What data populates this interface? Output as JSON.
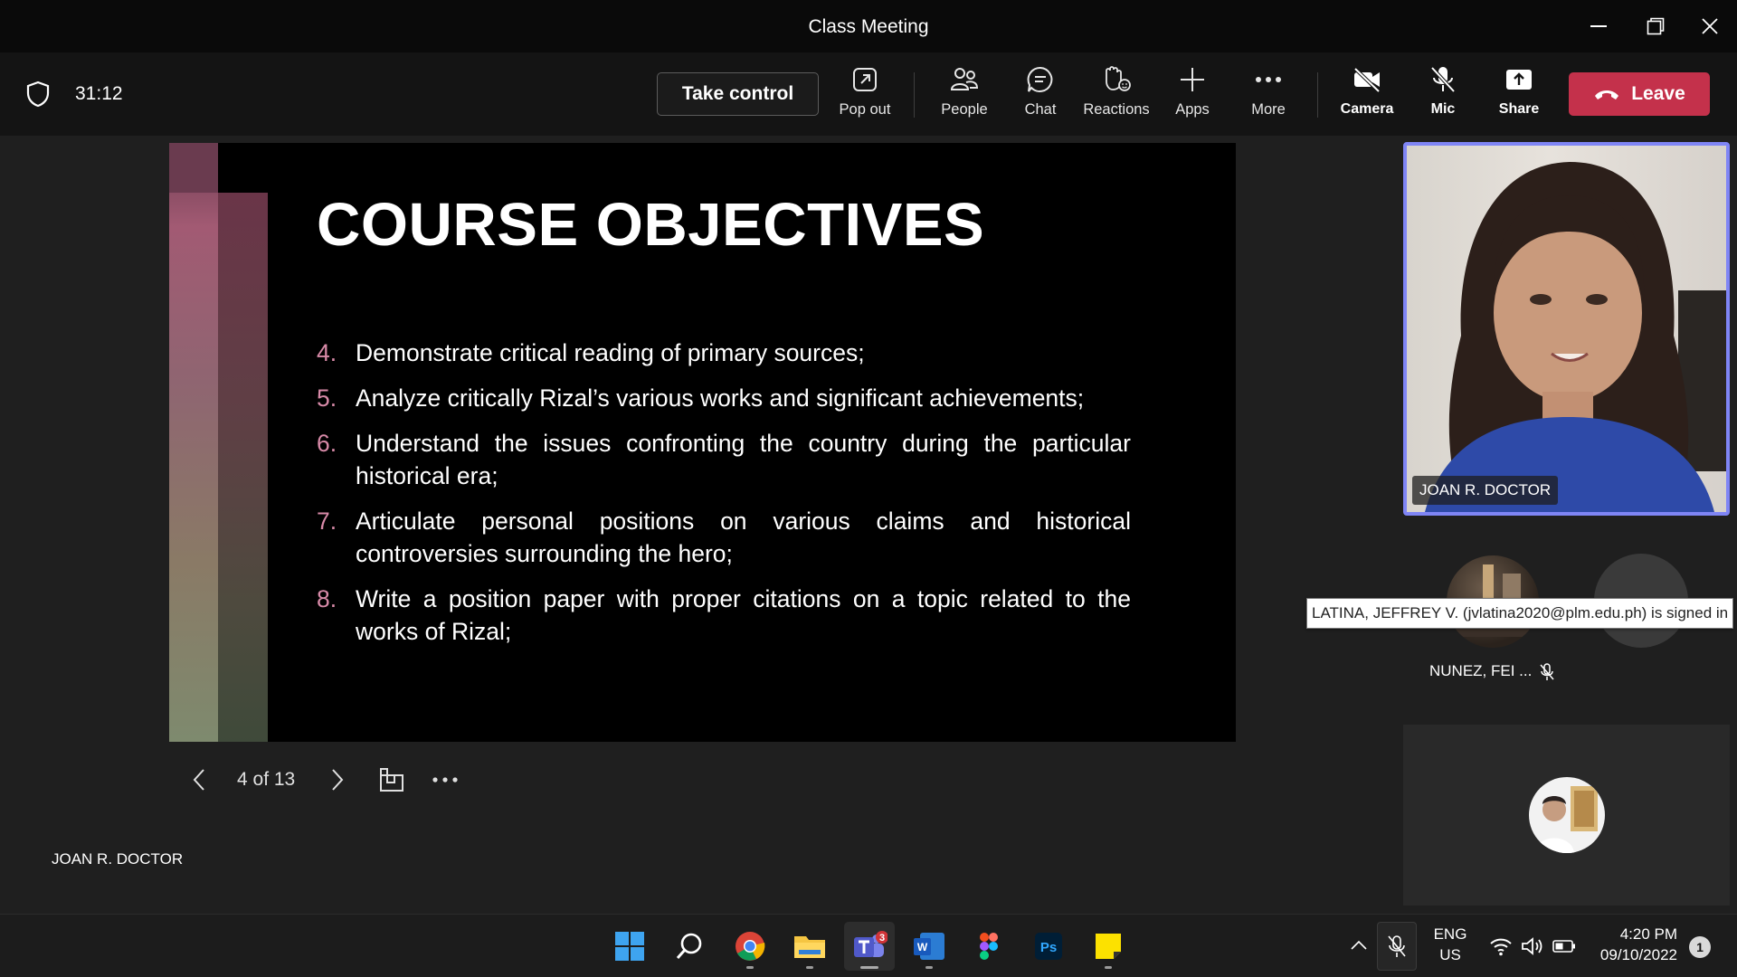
{
  "window": {
    "title": "Class Meeting"
  },
  "toolbar": {
    "timer": "31:12",
    "take_control": "Take control",
    "pop_out": "Pop out",
    "people": "People",
    "chat": "Chat",
    "reactions": "Reactions",
    "apps": "Apps",
    "more": "More",
    "camera": "Camera",
    "mic": "Mic",
    "share": "Share",
    "leave": "Leave"
  },
  "slide": {
    "title": "COURSE OBJECTIVES",
    "objectives": [
      {
        "num": "4.",
        "text": "Demonstrate critical reading of primary sources;"
      },
      {
        "num": "5.",
        "text": "Analyze critically Rizal’s various works and significant achievements;"
      },
      {
        "num": "6.",
        "text": "Understand the issues confronting the country during the particular historical era;"
      },
      {
        "num": "7.",
        "text": "Articulate personal positions on various claims and historical controversies surrounding the hero;"
      },
      {
        "num": "8.",
        "text": "Write a position paper with proper citations on a topic related to the works of Rizal;"
      }
    ],
    "counter": "4 of 13",
    "presenter": "JOAN R. DOCTOR"
  },
  "participants": {
    "main_video_name": "JOAN R. DOCTOR",
    "tooltip": "LATINA, JEFFREY V. (jvlatina2020@plm.edu.ph) is signed in",
    "second_name": "NUNEZ, FEI ..."
  },
  "taskbar": {
    "teams_badge": "3",
    "lang_top": "ENG",
    "lang_bottom": "US",
    "time": "4:20 PM",
    "date": "09/10/2022",
    "notification_count": "1"
  },
  "colors": {
    "leave": "#c4314b",
    "active_speaker_border": "#7f85f5",
    "objective_number": "#d88aa8"
  }
}
